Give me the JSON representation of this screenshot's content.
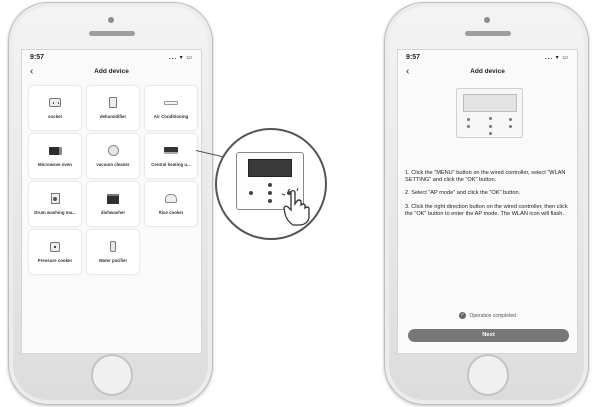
{
  "left_screen": {
    "status": {
      "time": "9:57",
      "icons": "... ▾ ▭"
    },
    "nav": {
      "back": "‹",
      "title": "Add device"
    },
    "devices": [
      {
        "label": "socket",
        "icon": "socket-icon"
      },
      {
        "label": "dehumidifier",
        "icon": "dehumidifier-icon"
      },
      {
        "label": "Air Conditioning",
        "icon": "air-conditioner-icon"
      },
      {
        "label": "Microwave oven",
        "icon": "microwave-icon"
      },
      {
        "label": "vacuum cleaner",
        "icon": "vacuum-cleaner-icon"
      },
      {
        "label": "Central heating u...",
        "icon": "central-heating-icon"
      },
      {
        "label": "Drum washing ma...",
        "icon": "washing-machine-icon"
      },
      {
        "label": "dishwasher",
        "icon": "dishwasher-icon"
      },
      {
        "label": "Rice cooker",
        "icon": "rice-cooker-icon"
      },
      {
        "label": "Pressure cooker",
        "icon": "pressure-cooker-icon"
      },
      {
        "label": "Water purifier",
        "icon": "water-purifier-icon"
      }
    ]
  },
  "right_screen": {
    "status": {
      "time": "9:57",
      "icons": "... ▾ ▭"
    },
    "nav": {
      "back": "‹",
      "title": "Add device"
    },
    "instructions": [
      "1. Click the \"MENU\" button on the wired controller, select \"WLAN SETTING\" and click the \"OK\" button.",
      "2. Select \"AP mode\" and click the \"OK\" button.",
      "3. Click the right direction button on the wired controller, then click the \"OK\" button to enter the AP mode. The WLAN icon will flash."
    ],
    "operation_status": "Operation completed",
    "check_glyph": "✓",
    "next_button": "Next"
  },
  "colors": {
    "button_gray": "#777777",
    "phone_frame": "#dcdcdc",
    "screen_bg": "#fafafa"
  }
}
